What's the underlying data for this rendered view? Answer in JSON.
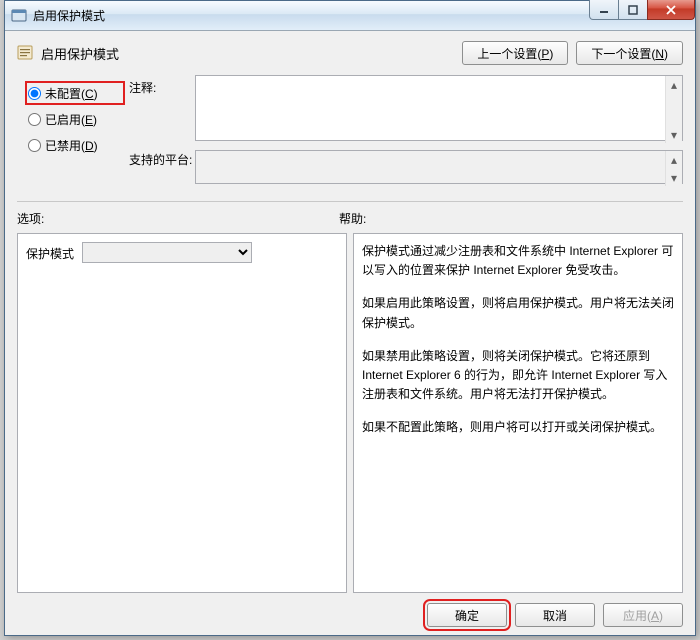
{
  "window": {
    "title": "启用保护模式"
  },
  "header": {
    "title": "启用保护模式",
    "prev_btn": "上一个设置(P)",
    "next_btn": "下一个设置(N)"
  },
  "radios": {
    "not_configured": "未配置(C)",
    "enabled": "已启用(E)",
    "disabled": "已禁用(D)",
    "selected": "not_configured"
  },
  "labels": {
    "comment": "注释:",
    "platform": "支持的平台:",
    "options": "选项:",
    "help": "帮助:",
    "protect_mode": "保护模式"
  },
  "help": {
    "p1": "保护模式通过减少注册表和文件系统中 Internet Explorer 可以写入的位置来保护 Internet Explorer 免受攻击。",
    "p2": "如果启用此策略设置，则将启用保护模式。用户将无法关闭保护模式。",
    "p3": "如果禁用此策略设置，则将关闭保护模式。它将还原到 Internet Explorer 6 的行为，即允许 Internet Explorer 写入注册表和文件系统。用户将无法打开保护模式。",
    "p4": "如果不配置此策略，则用户将可以打开或关闭保护模式。"
  },
  "footer": {
    "ok": "确定",
    "cancel": "取消",
    "apply": "应用(A)"
  }
}
